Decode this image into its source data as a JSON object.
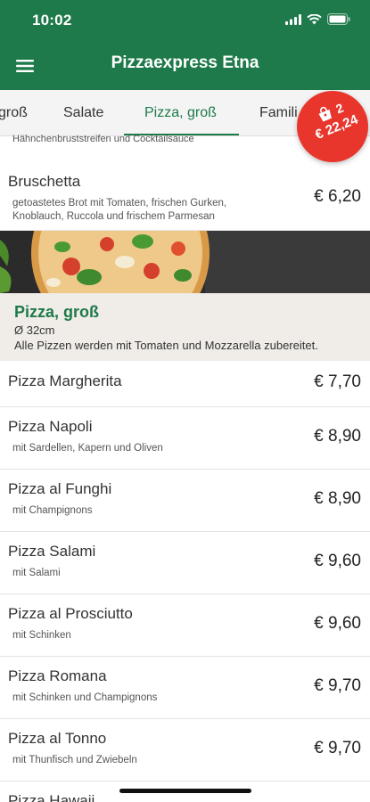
{
  "status": {
    "time": "10:02"
  },
  "app": {
    "title": "Pizzaexpress Etna",
    "accent": "#1e7a4a",
    "cart_color": "#e8362c"
  },
  "tabs": [
    {
      "label": "groß",
      "active": false
    },
    {
      "label": "Salate",
      "active": false
    },
    {
      "label": "Pizza, groß",
      "active": true
    },
    {
      "label": "Famili",
      "active": false
    }
  ],
  "cart": {
    "count": "2",
    "total": "€ 22,24",
    "icon": "shopping-bag-icon"
  },
  "previous_section": {
    "partial_text": "Hähnchenbruststreifen und Cocktailsauce",
    "item": {
      "name": "Bruschetta",
      "desc_line1": "getoastetes Brot mit Tomaten, frischen Gurken,",
      "desc_line2": "Knoblauch, Ruccola und frischem Parmesan",
      "price": "€ 6,20"
    }
  },
  "section": {
    "title": "Pizza, groß",
    "size": "Ø 32cm",
    "note": "Alle Pizzen werden mit Tomaten und Mozzarella zubereitet."
  },
  "items": [
    {
      "name": "Pizza Margherita",
      "desc": "",
      "price": "€ 7,70"
    },
    {
      "name": "Pizza Napoli",
      "desc": "mit Sardellen, Kapern und Oliven",
      "price": "€ 8,90"
    },
    {
      "name": "Pizza al Funghi",
      "desc": "mit Champignons",
      "price": "€ 8,90"
    },
    {
      "name": "Pizza Salami",
      "desc": "mit Salami",
      "price": "€ 9,60"
    },
    {
      "name": "Pizza al Prosciutto",
      "desc": "mit Schinken",
      "price": "€ 9,60"
    },
    {
      "name": "Pizza Romana",
      "desc": "mit Schinken und Champignons",
      "price": "€ 9,70"
    },
    {
      "name": "Pizza al Tonno",
      "desc": "mit Thunfisch und Zwiebeln",
      "price": "€ 9,70"
    },
    {
      "name": "Pizza Hawaii",
      "desc": "",
      "price": ""
    }
  ]
}
